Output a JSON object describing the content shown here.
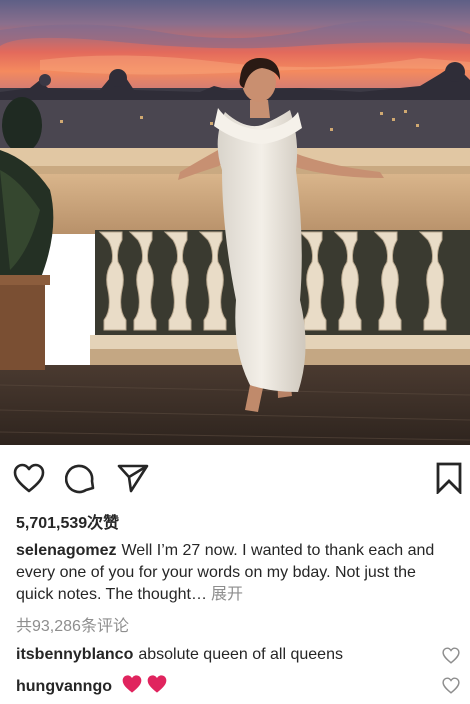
{
  "post": {
    "photo_alt": "Woman in white dress sitting on a balustrade at sunset over a city"
  },
  "actions": {
    "like_icon": "heart-outline-icon",
    "comment_icon": "comment-bubble-icon",
    "share_icon": "send-paper-plane-icon",
    "save_icon": "bookmark-icon"
  },
  "likes_text": "5,701,539次赞",
  "caption": {
    "username": "selenagomez",
    "text": "Well I’m 27 now. I wanted to thank each and every one of you for your words on my bday. Not just the quick notes. The thought…",
    "more_label": "展开"
  },
  "view_comments": "共93,286条评论",
  "comments": [
    {
      "username": "itsbennyblanco",
      "text": "absolute queen of all queens"
    },
    {
      "username": "hungvanngo",
      "text": ""
    }
  ],
  "colors": {
    "text": "#262626",
    "muted": "#8e8e8e",
    "heart_emoji": "#e0245e"
  }
}
